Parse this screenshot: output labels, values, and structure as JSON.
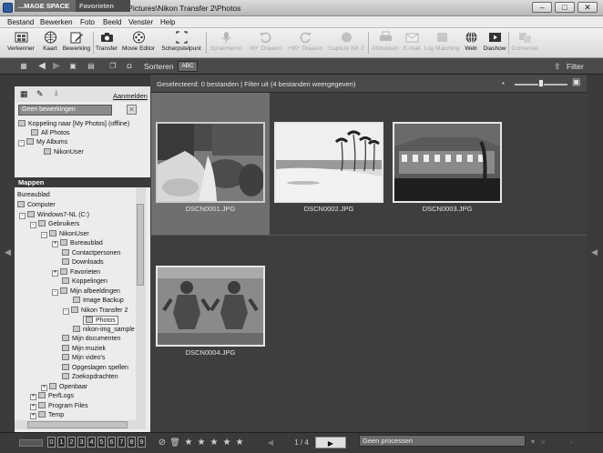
{
  "window": {
    "title": "ViewNX 2 - C:\\Users\\NikonUser\\Pictures\\Nikon Transfer 2\\Photos"
  },
  "menu": [
    "Bestand",
    "Bewerken",
    "Foto",
    "Beeld",
    "Venster",
    "Help"
  ],
  "toolbar": {
    "items": [
      {
        "label": "Verkenner",
        "enabled": true,
        "icon": "explorer-icon"
      },
      {
        "label": "Kaart",
        "enabled": true,
        "icon": "globe-icon"
      },
      {
        "label": "Bewerking",
        "enabled": true,
        "icon": "edit-pencil-icon"
      },
      {
        "label": "Transfer",
        "enabled": true,
        "icon": "camera-icon"
      },
      {
        "label": "Movie Editor",
        "enabled": true,
        "icon": "film-reel-icon"
      },
      {
        "label": "Scherpstelpunt",
        "enabled": true,
        "icon": "focus-point-icon"
      },
      {
        "label": "Sprakmemo",
        "enabled": false,
        "icon": "voice-memo-icon"
      },
      {
        "label": "-90° Draaien",
        "enabled": false,
        "icon": "rotate-left-icon"
      },
      {
        "label": "+90° Draaien",
        "enabled": false,
        "icon": "rotate-right-icon"
      },
      {
        "label": "Capture NX 2",
        "enabled": false,
        "icon": "capture-nx-icon"
      },
      {
        "label": "Afdrukken",
        "enabled": false,
        "icon": "print-icon"
      },
      {
        "label": "E-mail",
        "enabled": false,
        "icon": "email-icon"
      },
      {
        "label": "Log Matching",
        "enabled": false,
        "icon": "log-matching-icon"
      },
      {
        "label": "Web",
        "enabled": true,
        "icon": "web-icon"
      },
      {
        "label": "Diashow",
        "enabled": true,
        "icon": "slideshow-icon"
      },
      {
        "label": "Conversie",
        "enabled": false,
        "icon": "convert-icon"
      }
    ]
  },
  "bar2": {
    "sort_label": "Sorteren",
    "sort_button": "ABC",
    "filter_label": "Filter"
  },
  "left_panel": {
    "tabs": [
      "...MAGE SPACE",
      "Favorieten"
    ],
    "sign_in": "Aanmelden",
    "edit_search_placeholder": "Geen bewerkingen",
    "links": [
      "Koppeling naar [My Photos] (offline)",
      "All Photos",
      "My Albums",
      "NikonUser"
    ],
    "folders_header": "Mappen",
    "tree": [
      "Bureaublad",
      "Computer",
      "Windows7-NL (C:)",
      "Gebruikers",
      "NikonUser",
      "Bureaublad",
      "Contactpersonen",
      "Downloads",
      "Favorieten",
      "Koppelingen",
      "Mijn afbeeldingen",
      "Image Backup",
      "Nikon Transfer 2",
      "Photos",
      "nikon-img_sample",
      "Mijn documenten",
      "Mijn muziek",
      "Mijn video's",
      "Opgeslagen spellen",
      "Zoekopdrachten",
      "Openbaar",
      "PerfLogs",
      "Program Files",
      "Temp"
    ]
  },
  "content": {
    "status": "Geselecteerd: 0 bestanden | Filter uit  (4 bestanden weergegeven)",
    "thumbnails": [
      {
        "name": "DSCN0001.JPG",
        "selected": true
      },
      {
        "name": "DSCN0002.JPG",
        "selected": false
      },
      {
        "name": "DSCN0003.JPG",
        "selected": false
      },
      {
        "name": "DSCN0004.JPG",
        "selected": false
      }
    ]
  },
  "bottom": {
    "numbers": [
      "0",
      "1",
      "2",
      "3",
      "4",
      "5",
      "6",
      "7",
      "8",
      "9"
    ],
    "page": "1 / 4",
    "process": "Geen processen"
  }
}
